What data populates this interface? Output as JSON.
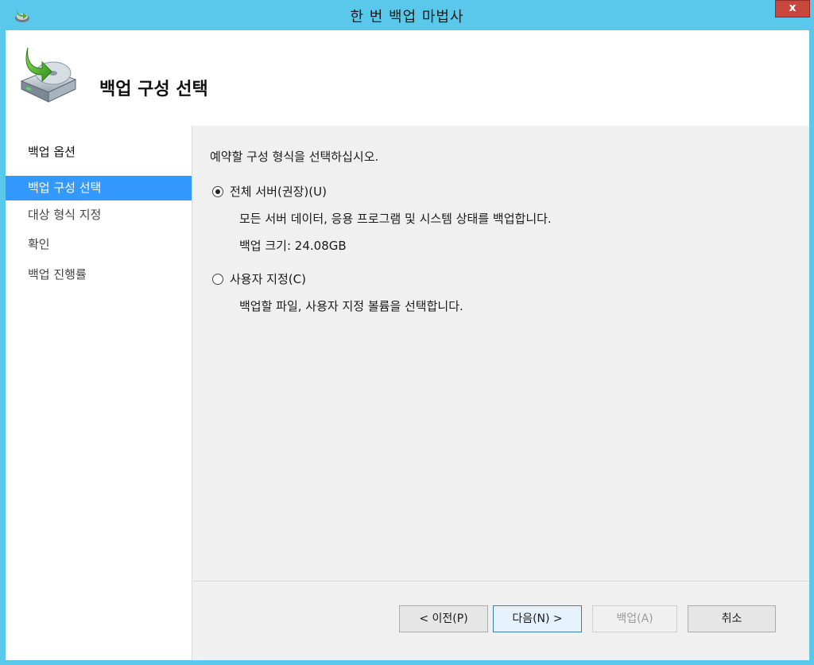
{
  "window": {
    "title": "한 번 백업 마법사",
    "close_label": "x"
  },
  "header": {
    "title": "백업 구성 선택"
  },
  "nav": {
    "items": [
      {
        "label": "백업 옵션"
      },
      {
        "label": "백업 구성 선택",
        "active": true
      },
      {
        "label": "대상 형식 지정"
      },
      {
        "label": "확인"
      },
      {
        "label": "백업 진행률"
      }
    ]
  },
  "content": {
    "instruction": "예약할 구성 형식을 선택하십시오.",
    "options": [
      {
        "label": "전체 서버(권장)(U)",
        "selected": true,
        "description": "모든 서버 데이터, 응용 프로그램 및 시스템 상태를 백업합니다.",
        "size_text": "백업 크기: 24.08GB"
      },
      {
        "label": "사용자 지정(C)",
        "selected": false,
        "description": "백업할 파일, 사용자 지정 볼륨을 선택합니다."
      }
    ]
  },
  "buttons": {
    "back": "< 이전(P)",
    "next": "다음(N) >",
    "backup": "백업(A)",
    "cancel": "취소"
  },
  "colors": {
    "titlebar": "#59c8ea",
    "selection": "#3399ff",
    "close": "#c9463d"
  }
}
